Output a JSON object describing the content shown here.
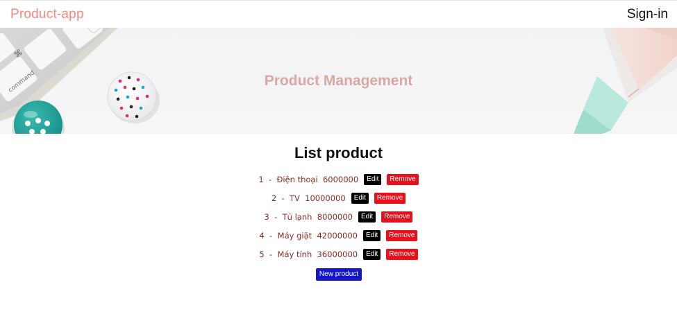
{
  "navbar": {
    "brand": "Product-app",
    "signin": "Sign-in"
  },
  "hero": {
    "title": "Product Management",
    "keyboard_key_label": "command",
    "keyboard_key_symbol": "⌘"
  },
  "list": {
    "title": "List product",
    "edit_label": "Edit",
    "remove_label": "Remove",
    "separator": "-",
    "rows": [
      {
        "index": "1",
        "name": "Điện thoại",
        "price": "6000000"
      },
      {
        "index": "2",
        "name": "TV",
        "price": "10000000"
      },
      {
        "index": "3",
        "name": "Tủ lạnh",
        "price": "8000000"
      },
      {
        "index": "4",
        "name": "Máy giặt",
        "price": "42000000"
      },
      {
        "index": "5",
        "name": "Máy tính",
        "price": "36000000"
      }
    ],
    "new_button": "New product"
  },
  "colors": {
    "brand": "#f08a7e",
    "hero_title": "#d7a8a6",
    "row_text": "#8a2a22",
    "edit_button": "#000000",
    "remove_button": "#e8101a",
    "new_button": "#1414c8"
  }
}
